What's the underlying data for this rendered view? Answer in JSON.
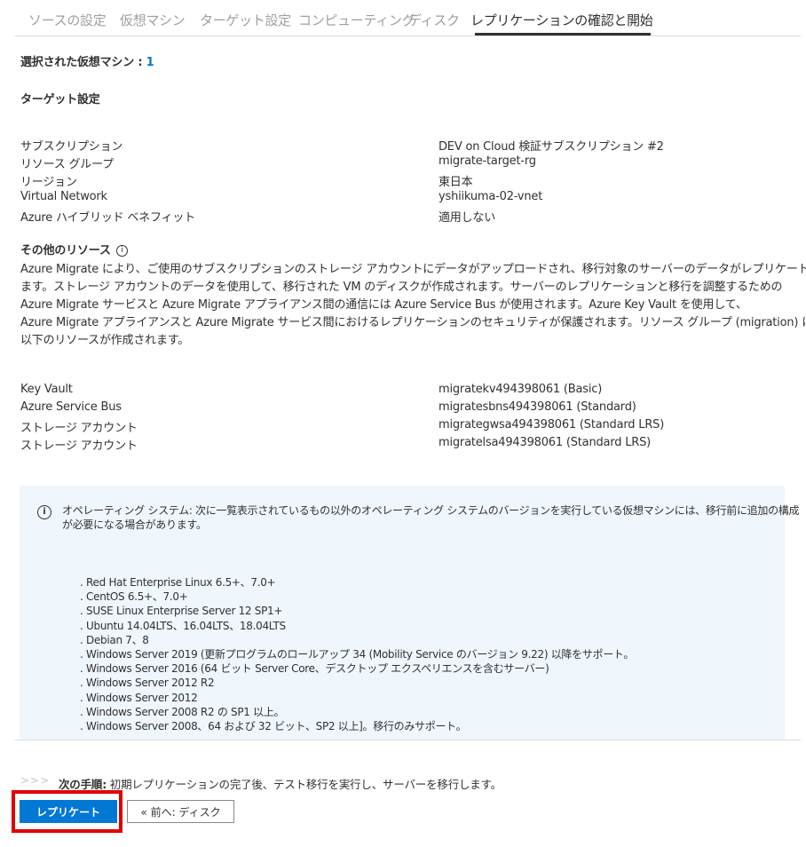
{
  "tabs": [
    {
      "label": "ソースの設定"
    },
    {
      "label": "仮想マシン"
    },
    {
      "label": "ターゲット設定"
    },
    {
      "label": "コンピューティング"
    },
    {
      "label": "ディスク"
    },
    {
      "label": "レプリケーションの確認と開始"
    }
  ],
  "summary": {
    "selected_vms_label": "選択された仮想マシン : ",
    "selected_vms_count": "1"
  },
  "target_settings": {
    "heading": "ターゲット設定",
    "rows": [
      {
        "label": "サブスクリプション",
        "value": "DEV on Cloud 検証サブスクリプション #2"
      },
      {
        "label": "リソース グループ",
        "value": "migrate-target-rg"
      },
      {
        "label": "リージョン",
        "value": "東日本"
      },
      {
        "label": "Virtual Network",
        "value": "yshiikuma-02-vnet"
      },
      {
        "label": "Azure ハイブリッド ベネフィット",
        "value": "適用しない"
      }
    ]
  },
  "other_resources": {
    "heading": "その他のリソース",
    "info_glyph": "i",
    "description_lines": [
      "Azure Migrate により、ご使用のサブスクリプションのストレージ アカウントにデータがアップロードされ、移行対象のサーバーのデータがレプリケートされ",
      "ます。ストレージ アカウントのデータを使用して、移行された VM のディスクが作成されます。サーバーのレプリケーションと移行を調整するための",
      "Azure Migrate サービスと Azure Migrate アプライアンス間の通信には Azure Service Bus が使用されます。Azure Key Vault を使用して、",
      "Azure Migrate アプライアンスと Azure Migrate サービス間におけるレプリケーションのセキュリティが保護されます。リソース グループ (migration) に",
      "以下のリソースが作成されます。"
    ],
    "rows": [
      {
        "label": "Key Vault",
        "value": "migratekv494398061 (Basic)"
      },
      {
        "label": "Azure Service Bus",
        "value": "migratesbns494398061 (Standard)"
      },
      {
        "label": "ストレージ アカウント",
        "value": "migrategwsa494398061 (Standard LRS)"
      },
      {
        "label": "ストレージ アカウント",
        "value": "migratelsa494398061 (Standard LRS)"
      }
    ]
  },
  "os_notice": {
    "info_glyph": "i",
    "message_lines": [
      "オペレーティング システム: 次に一覧表示されているもの以外のオペレーティング システムのバージョンを実行している仮想マシンには、移行前に追加の構成",
      "が必要になる場合があります。"
    ],
    "items": [
      ". Red Hat Enterprise Linux 6.5+、7.0+",
      ". CentOS 6.5+、7.0+",
      ". SUSE Linux Enterprise Server 12 SP1+",
      ". Ubuntu 14.04LTS、16.04LTS、18.04LTS",
      ". Debian 7、8",
      ". Windows Server 2019 (更新プログラムのロールアップ 34 (Mobility Service のバージョン 9.22) 以降をサポート。",
      ". Windows Server 2016 (64 ビット Server Core、デスクトップ エクスペリエンスを含むサーバー)",
      ". Windows Server 2012 R2",
      ". Windows Server 2012",
      ". Windows Server 2008 R2 の SP1 以上。",
      ". Windows Server 2008、64 および 32 ビット、SP2 以上]。移行のみサポート。"
    ]
  },
  "next_steps": {
    "chevrons": ">>>",
    "label": "次の手順:",
    "text": " 初期レプリケーションの完了後、テスト移行を実行し、サーバーを移行します。"
  },
  "buttons": {
    "replicate": "レプリケート",
    "previous": "« 前へ: ディスク"
  },
  "colors": {
    "accent": "#0078d4",
    "highlight": "#e00000",
    "info_background": "#eff6fc"
  }
}
